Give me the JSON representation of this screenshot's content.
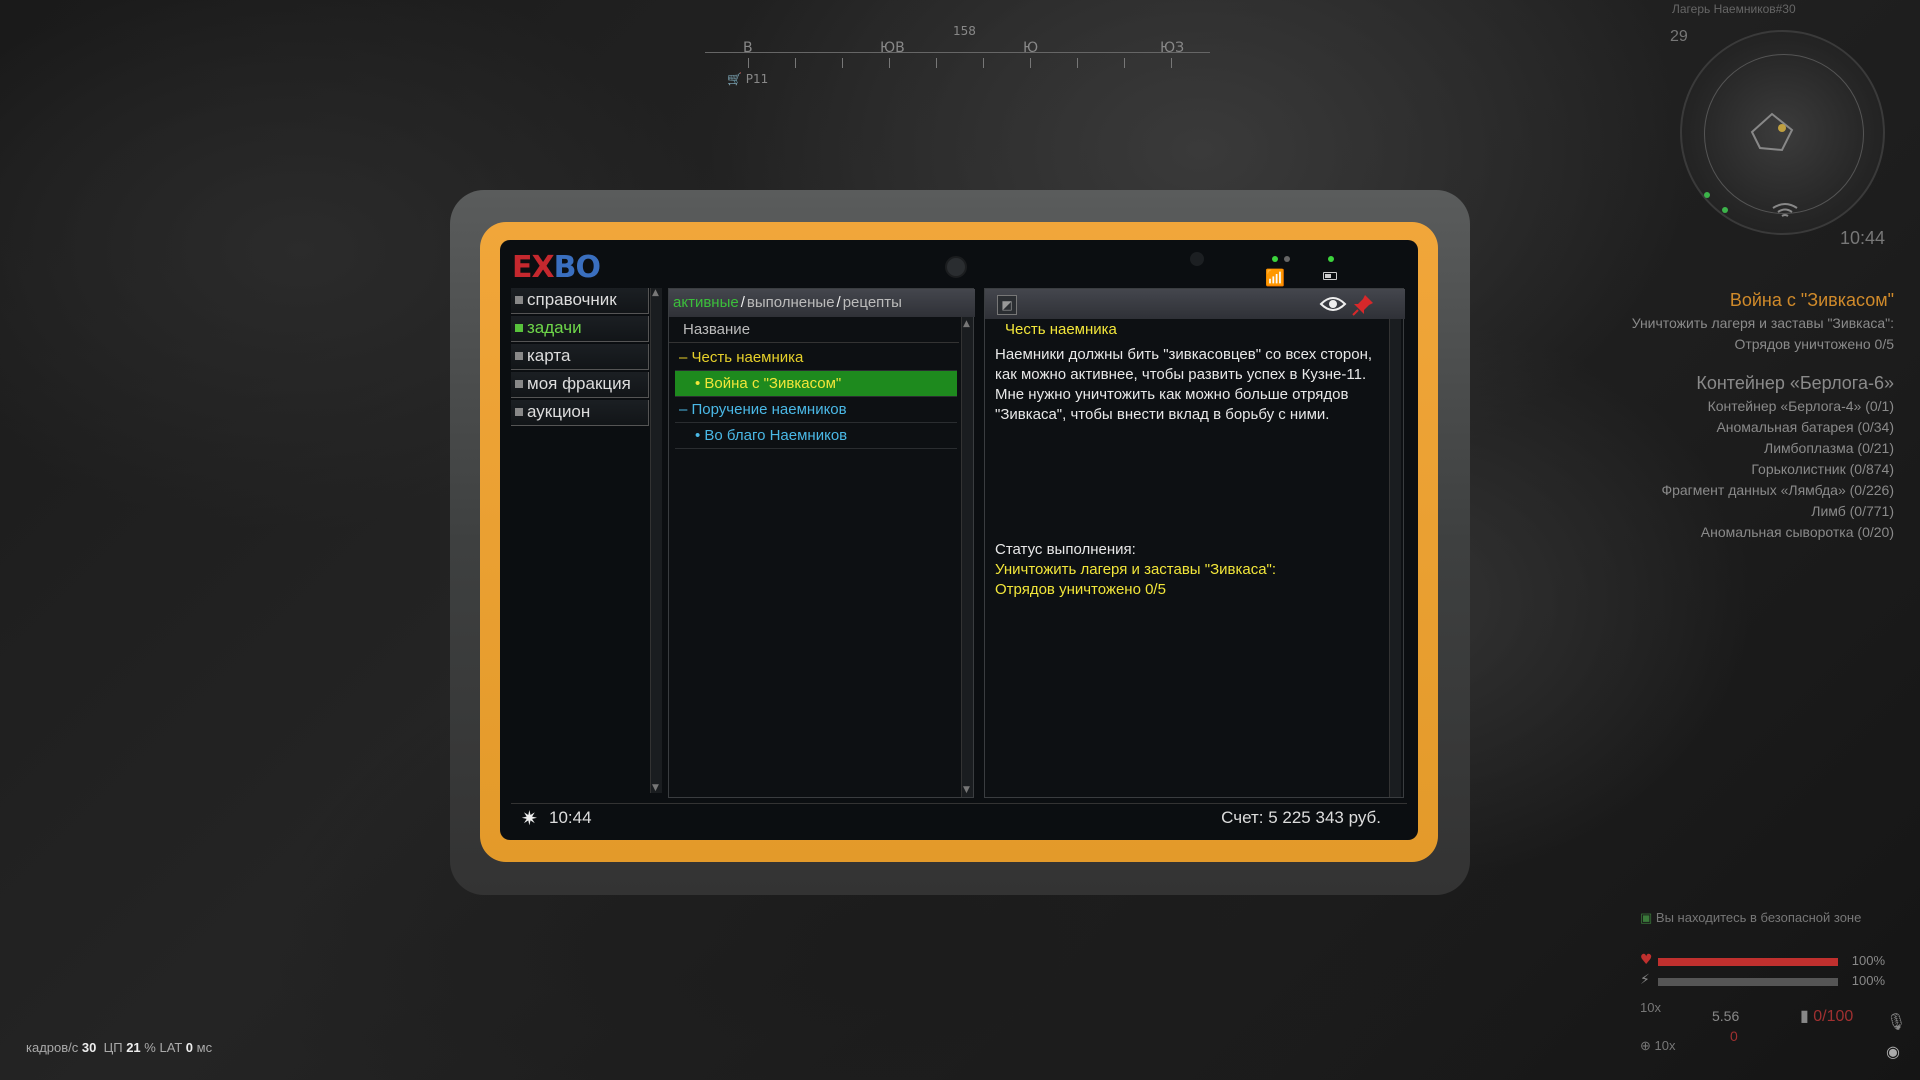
{
  "hud": {
    "compass": {
      "heading": "158",
      "labels": [
        "В",
        "ЮВ",
        "Ю",
        "ЮЗ"
      ],
      "marker": "Р11"
    },
    "minimap": {
      "location": "Лагерь Наемников#30",
      "level": "29",
      "time": "10:44"
    },
    "objectives": [
      {
        "title": "Война с \"Зивкасом\"",
        "lines": [
          "Уничтожить лагеря и заставы \"Зивкаса\":",
          "Отрядов уничтожено 0/5"
        ]
      },
      {
        "title": "Контейнер «Берлога-6»",
        "lines": [
          "Контейнер «Берлога-4» (0/1)",
          "Аномальная батарея (0/34)",
          "Лимбоплазма (0/21)",
          "Горьколистник (0/874)",
          "Фрагмент данных «Лямбда» (0/226)",
          "Лимб (0/771)",
          "Аномальная сыворотка (0/20)"
        ]
      }
    ],
    "safe_zone": "Вы находитесь в безопасной зоне",
    "health": {
      "value": "100%",
      "fill": 1.0,
      "color": "#c0302e"
    },
    "stamina": {
      "value": "100%",
      "fill": 1.0,
      "color": "#555555"
    },
    "ammo": {
      "zoom": "10x",
      "caliber": "5.56",
      "count": "0",
      "max": "0/100",
      "zoom2": "10x"
    },
    "stats": {
      "fps_label": "кадров/с",
      "fps": "30",
      "cpu_label": "ЦП",
      "cpu": "21",
      "cpu_unit": "%",
      "lat_label": "LAT",
      "lat": "0",
      "lat_unit": "мс"
    }
  },
  "device": {
    "logo": {
      "part1": "EX",
      "part2": "BO"
    },
    "nav": [
      {
        "label": "справочник",
        "active": false
      },
      {
        "label": "задачи",
        "active": true
      },
      {
        "label": "карта",
        "active": false
      },
      {
        "label": "моя фракция",
        "active": false
      },
      {
        "label": "аукцион",
        "active": false
      }
    ],
    "tabs": {
      "active": "активные",
      "done": "выполненые",
      "recipes": "рецепты",
      "sep": "/"
    },
    "list_header": "Название",
    "quests": [
      {
        "type": "group",
        "label": "– Честь наемника",
        "color": "yellow"
      },
      {
        "type": "task",
        "label": "• Война с \"Зивкасом\"",
        "selected": true
      },
      {
        "type": "group",
        "label": "– Поручение наемников",
        "color": "blue"
      },
      {
        "type": "task",
        "label": "• Во благо Наемников",
        "selected": false
      }
    ],
    "detail": {
      "title": "Честь наемника",
      "body": "Наемники должны бить \"зивкасовцев\" со всех сторон, как можно активнее, чтобы развить успех в Кузне-11. Мне нужно уничтожить как можно больше отрядов \"Зивкаса\", чтобы внести вклад в борьбу с ними.",
      "status_label": "Статус выполнения:",
      "status_lines": [
        "Уничтожить лагеря и заставы \"Зивкаса\":",
        "Отрядов уничтожено 0/5"
      ]
    },
    "footer": {
      "time": "10:44",
      "balance": "Счет: 5 225 343 руб."
    }
  },
  "colors": {
    "accent_frame": "#f1a63a",
    "active_green": "#1e8a1e",
    "quest_yellow": "#f2e63a",
    "quest_blue": "#4ab8e6"
  }
}
